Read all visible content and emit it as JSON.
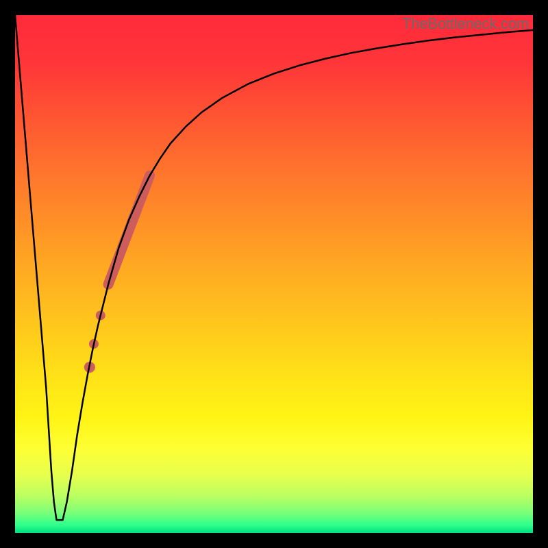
{
  "watermark": "TheBottleneck.com",
  "chart_data": {
    "type": "line",
    "title": "",
    "xlabel": "",
    "ylabel": "",
    "xlim": [
      0,
      100
    ],
    "ylim": [
      0,
      100
    ],
    "grid": false,
    "background": "vertical-gradient",
    "gradient_stops": [
      {
        "pos": 0.0,
        "color": "#ff2a3a"
      },
      {
        "pos": 0.09,
        "color": "#ff3539"
      },
      {
        "pos": 0.18,
        "color": "#ff5033"
      },
      {
        "pos": 0.28,
        "color": "#ff6e2e"
      },
      {
        "pos": 0.38,
        "color": "#ff8a28"
      },
      {
        "pos": 0.48,
        "color": "#ffa722"
      },
      {
        "pos": 0.58,
        "color": "#ffc21d"
      },
      {
        "pos": 0.68,
        "color": "#ffdd18"
      },
      {
        "pos": 0.78,
        "color": "#fff515"
      },
      {
        "pos": 0.84,
        "color": "#fdff35"
      },
      {
        "pos": 0.89,
        "color": "#e6ff4e"
      },
      {
        "pos": 0.93,
        "color": "#b8ff62"
      },
      {
        "pos": 0.96,
        "color": "#7dff78"
      },
      {
        "pos": 0.985,
        "color": "#2eff8c"
      },
      {
        "pos": 1.0,
        "color": "#00de7f"
      }
    ],
    "series": [
      {
        "name": "bottleneck-curve",
        "color": "#000000",
        "stroke_width": 2.5,
        "x": [
          0,
          1,
          2,
          3,
          4,
          5,
          6,
          6.5,
          7,
          7.5,
          8,
          8.8,
          9.2,
          10,
          11,
          12,
          13,
          14,
          15,
          16,
          18,
          20,
          22,
          24,
          26,
          28,
          30,
          33,
          36,
          40,
          45,
          50,
          55,
          60,
          65,
          70,
          75,
          80,
          85,
          90,
          95,
          100
        ],
        "y": [
          100,
          88,
          76,
          64,
          52,
          40,
          28,
          20,
          12,
          6,
          2.5,
          2.5,
          2.5,
          6,
          12,
          19,
          25,
          30.5,
          35.5,
          40,
          48,
          55,
          60.5,
          65,
          69,
          72.3,
          75.2,
          78.5,
          81.2,
          84,
          86.7,
          88.7,
          90.3,
          91.6,
          92.7,
          93.6,
          94.4,
          95.1,
          95.7,
          96.2,
          96.7,
          97.1
        ]
      }
    ],
    "highlights": {
      "band": {
        "color": "#cd5c5c",
        "opacity": 1.0,
        "width": 15,
        "x": [
          18.0,
          26.0
        ],
        "y": [
          48.0,
          69.0
        ]
      },
      "dots": [
        {
          "x": 16.5,
          "y": 42.0,
          "r": 7,
          "color": "#cd5c5c"
        },
        {
          "x": 15.2,
          "y": 36.5,
          "r": 7,
          "color": "#cd5c5c"
        },
        {
          "x": 14.4,
          "y": 32.0,
          "r": 8,
          "color": "#cd5c5c"
        }
      ]
    }
  }
}
